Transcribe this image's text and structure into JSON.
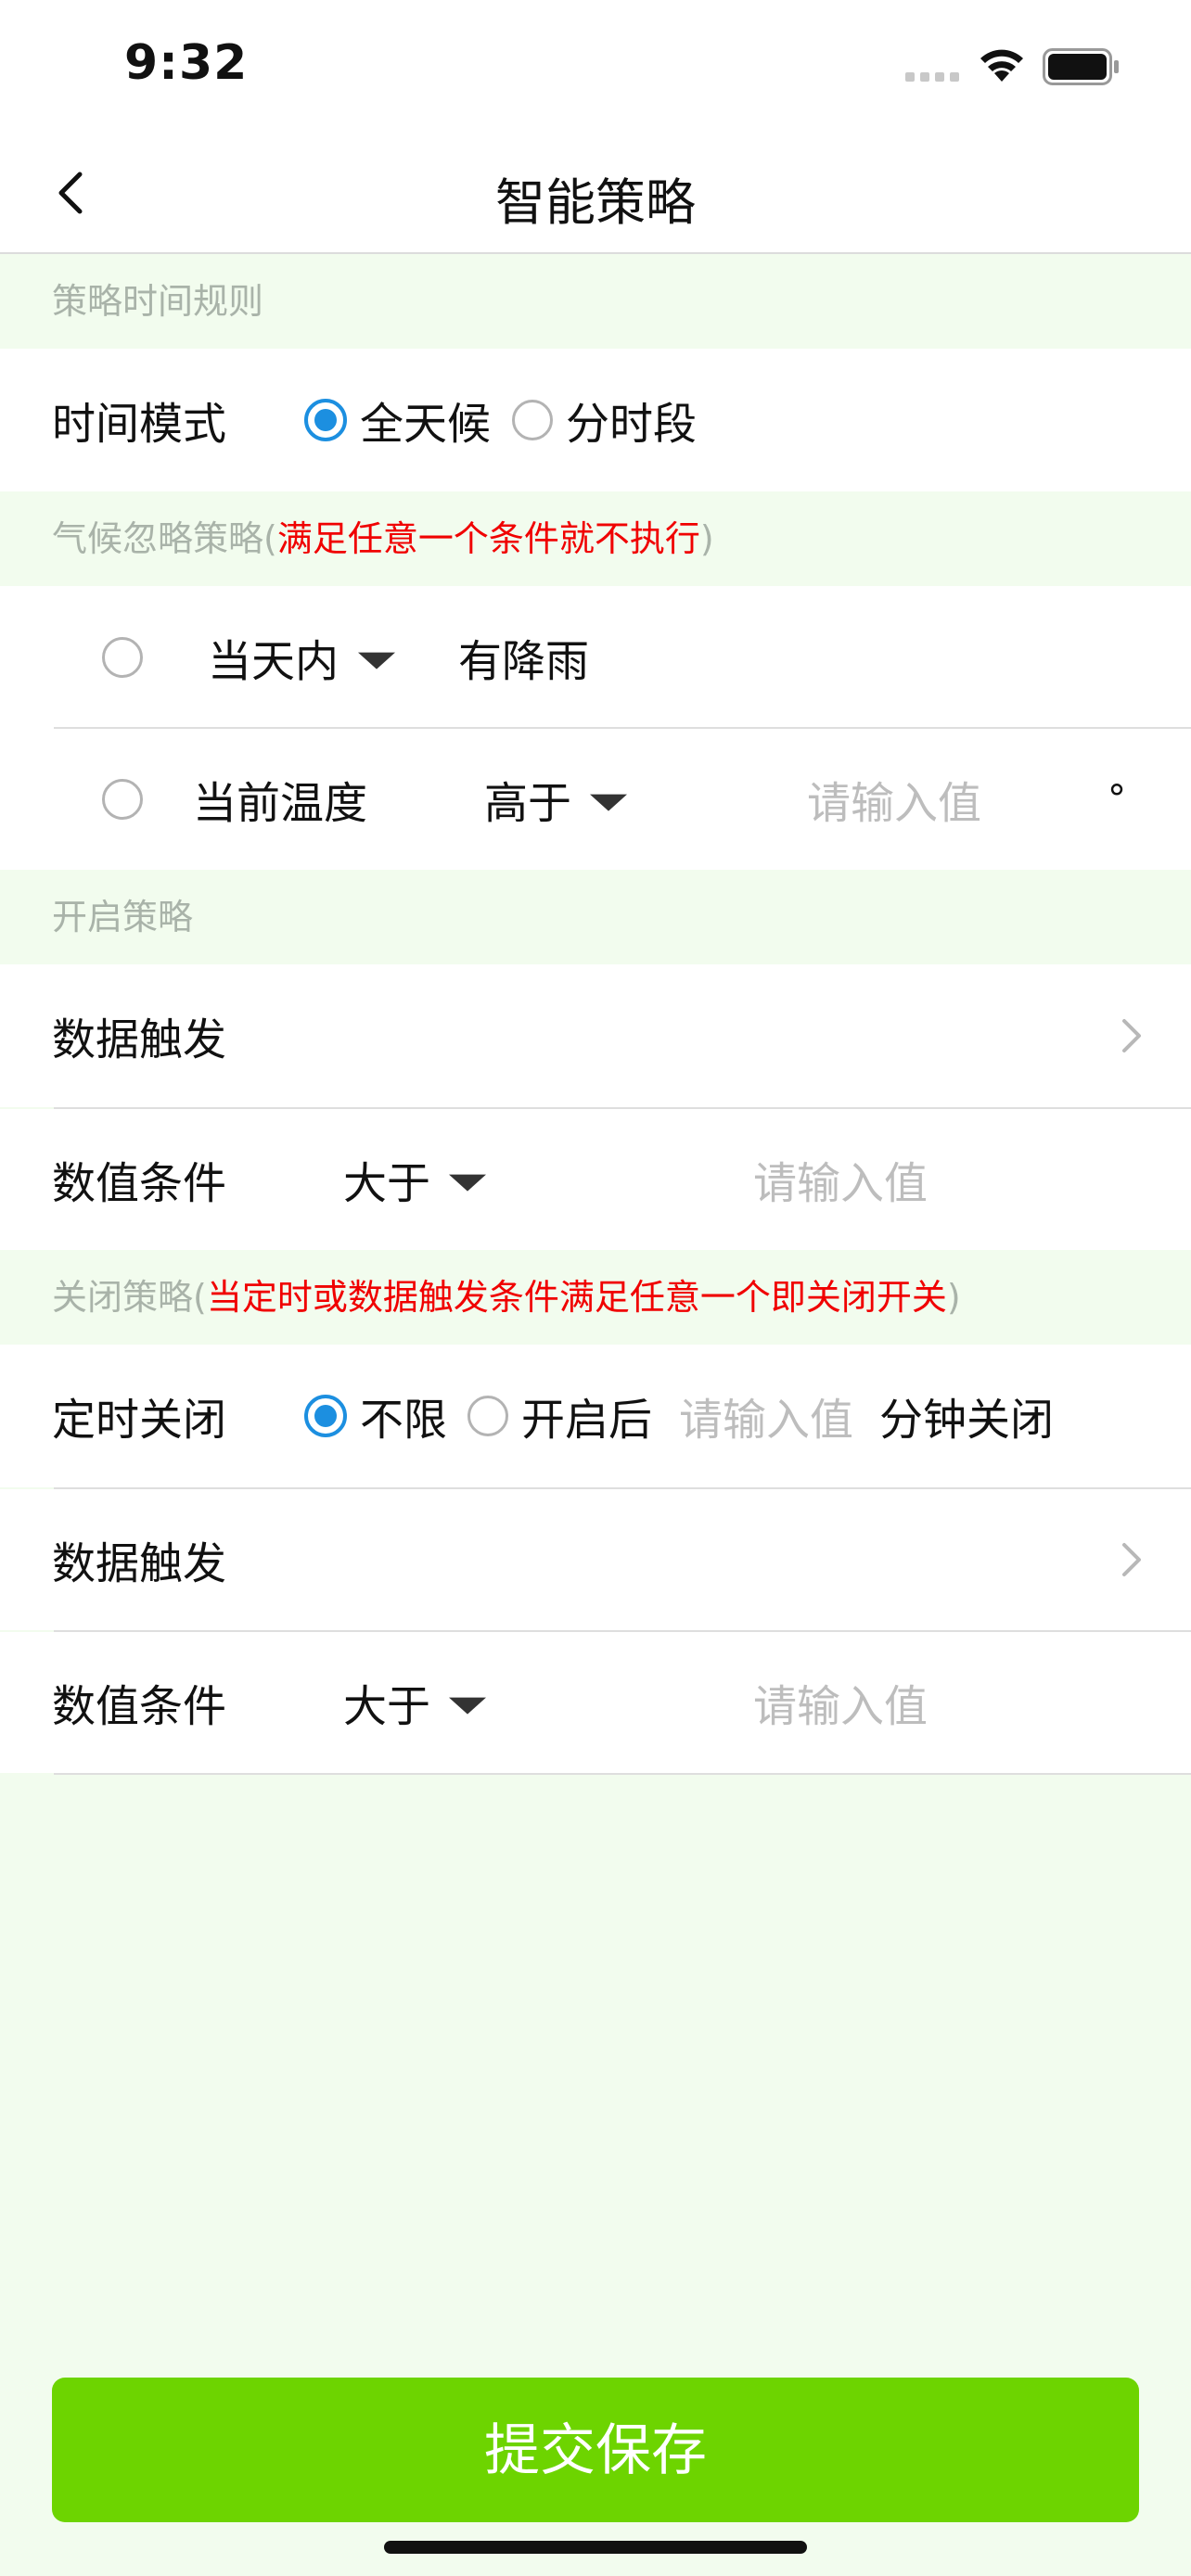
{
  "status": {
    "time": "9:32"
  },
  "nav": {
    "title": "智能策略"
  },
  "time_rule": {
    "header": "策略时间规则",
    "mode_label": "时间模式",
    "option_all_day": "全天候",
    "option_period": "分时段",
    "selected": "全天候"
  },
  "climate": {
    "header_prefix": "气候忽略策略(",
    "header_note": "满足任意一个条件就不执行",
    "header_suffix": ")",
    "rain": {
      "scope": "当天内",
      "event": "有降雨"
    },
    "temp": {
      "label": "当前温度",
      "compare": "高于",
      "placeholder": "请输入值",
      "unit": "°"
    }
  },
  "open": {
    "header": "开启策略",
    "data_trigger_label": "数据触发",
    "value_label": "数值条件",
    "compare": "大于",
    "placeholder": "请输入值"
  },
  "close": {
    "header_prefix": "关闭策略(",
    "header_note": "当定时或数据触发条件满足任意一个即关闭开关",
    "header_suffix": ")",
    "timer_label": "定时关闭",
    "option_unlimited": "不限",
    "option_after_open": "开启后",
    "placeholder": "请输入值",
    "minutes_suffix": "分钟关闭",
    "selected": "不限",
    "data_trigger_label": "数据触发",
    "value_label": "数值条件",
    "compare": "大于",
    "value_placeholder": "请输入值"
  },
  "submit_label": "提交保存",
  "colors": {
    "accent": "#1c8fe0",
    "submit": "#6dd400",
    "note_red": "#f00000",
    "section_bg": "#f2fcee"
  }
}
